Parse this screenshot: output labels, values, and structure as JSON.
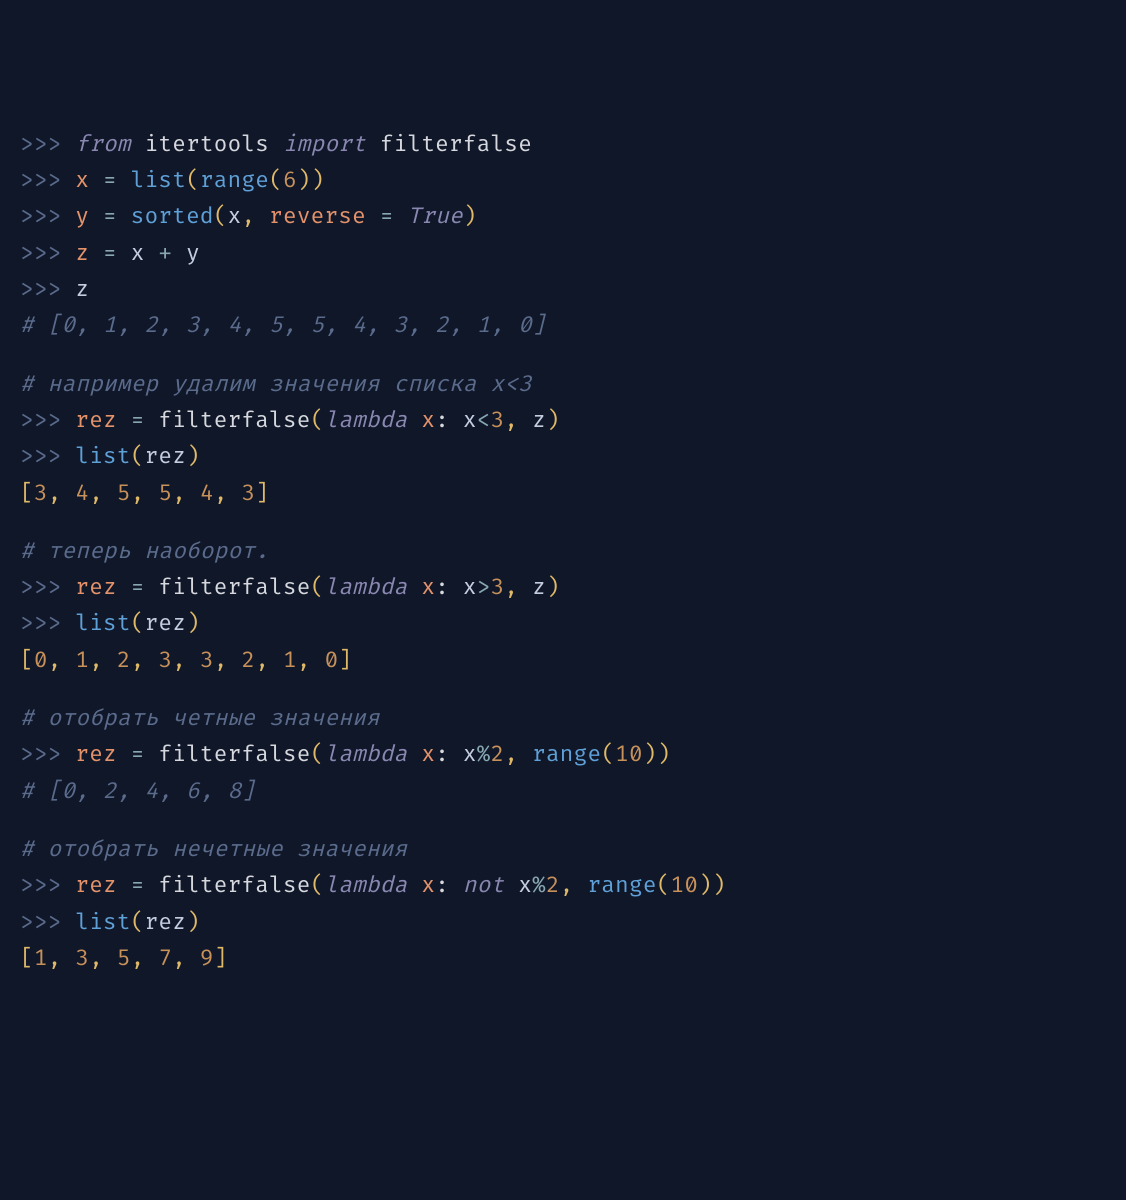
{
  "lines": [
    {
      "prompt": ">>> ",
      "segs": [
        {
          "t": "from ",
          "c": "c-kw"
        },
        {
          "t": "itertools ",
          "c": "c-ident"
        },
        {
          "t": "import ",
          "c": "c-kw"
        },
        {
          "t": "filterfalse",
          "c": "c-ident"
        }
      ]
    },
    {
      "prompt": ">>> ",
      "segs": [
        {
          "t": "x ",
          "c": "c-param"
        },
        {
          "t": "= ",
          "c": "c-op"
        },
        {
          "t": "list",
          "c": "c-fn"
        },
        {
          "t": "(",
          "c": "c-punct"
        },
        {
          "t": "range",
          "c": "c-fn"
        },
        {
          "t": "(",
          "c": "c-punct"
        },
        {
          "t": "6",
          "c": "c-num"
        },
        {
          "t": ")",
          "c": "c-punct"
        },
        {
          "t": ")",
          "c": "c-punct"
        }
      ]
    },
    {
      "prompt": ">>> ",
      "segs": [
        {
          "t": "y ",
          "c": "c-param"
        },
        {
          "t": "= ",
          "c": "c-op"
        },
        {
          "t": "sorted",
          "c": "c-fn"
        },
        {
          "t": "(",
          "c": "c-punct"
        },
        {
          "t": "x",
          "c": "c-var"
        },
        {
          "t": ", ",
          "c": "c-punct"
        },
        {
          "t": "reverse",
          "c": "c-param"
        },
        {
          "t": " = ",
          "c": "c-op"
        },
        {
          "t": "True",
          "c": "c-kw"
        },
        {
          "t": ")",
          "c": "c-punct"
        }
      ]
    },
    {
      "prompt": ">>> ",
      "segs": [
        {
          "t": "z ",
          "c": "c-param"
        },
        {
          "t": "= ",
          "c": "c-op"
        },
        {
          "t": "x ",
          "c": "c-var"
        },
        {
          "t": "+ ",
          "c": "c-op"
        },
        {
          "t": "y",
          "c": "c-var"
        }
      ]
    },
    {
      "prompt": ">>> ",
      "segs": [
        {
          "t": "z",
          "c": "c-var"
        }
      ]
    },
    {
      "prompt": "",
      "segs": [
        {
          "t": "# [0, 1, 2, 3, 4, 5, 5, 4, 3, 2, 1, 0]",
          "c": "c-comment"
        }
      ]
    },
    {
      "blank": true
    },
    {
      "prompt": "",
      "segs": [
        {
          "t": "# например удалим значения списка x<3",
          "c": "c-comment"
        }
      ]
    },
    {
      "prompt": ">>> ",
      "segs": [
        {
          "t": "rez ",
          "c": "c-param"
        },
        {
          "t": "= ",
          "c": "c-op"
        },
        {
          "t": "filterfalse",
          "c": "c-ident"
        },
        {
          "t": "(",
          "c": "c-punct"
        },
        {
          "t": "lambda ",
          "c": "c-kw"
        },
        {
          "t": "x",
          "c": "c-param"
        },
        {
          "t": ": ",
          "c": "c-punct-w"
        },
        {
          "t": "x",
          "c": "c-var"
        },
        {
          "t": "<",
          "c": "c-op"
        },
        {
          "t": "3",
          "c": "c-num"
        },
        {
          "t": ", ",
          "c": "c-punct"
        },
        {
          "t": "z",
          "c": "c-var"
        },
        {
          "t": ")",
          "c": "c-punct"
        }
      ]
    },
    {
      "prompt": ">>> ",
      "segs": [
        {
          "t": "list",
          "c": "c-fn"
        },
        {
          "t": "(",
          "c": "c-punct"
        },
        {
          "t": "rez",
          "c": "c-var"
        },
        {
          "t": ")",
          "c": "c-punct"
        }
      ]
    },
    {
      "prompt": "",
      "segs": [
        {
          "t": "[",
          "c": "c-punct"
        },
        {
          "t": "3",
          "c": "c-num"
        },
        {
          "t": ", ",
          "c": "c-punct"
        },
        {
          "t": "4",
          "c": "c-num"
        },
        {
          "t": ", ",
          "c": "c-punct"
        },
        {
          "t": "5",
          "c": "c-num"
        },
        {
          "t": ", ",
          "c": "c-punct"
        },
        {
          "t": "5",
          "c": "c-num"
        },
        {
          "t": ", ",
          "c": "c-punct"
        },
        {
          "t": "4",
          "c": "c-num"
        },
        {
          "t": ", ",
          "c": "c-punct"
        },
        {
          "t": "3",
          "c": "c-num"
        },
        {
          "t": "]",
          "c": "c-punct"
        }
      ]
    },
    {
      "blank": true
    },
    {
      "prompt": "",
      "segs": [
        {
          "t": "# теперь наоборот.",
          "c": "c-comment"
        }
      ]
    },
    {
      "prompt": ">>> ",
      "segs": [
        {
          "t": "rez ",
          "c": "c-param"
        },
        {
          "t": "= ",
          "c": "c-op"
        },
        {
          "t": "filterfalse",
          "c": "c-ident"
        },
        {
          "t": "(",
          "c": "c-punct"
        },
        {
          "t": "lambda ",
          "c": "c-kw"
        },
        {
          "t": "x",
          "c": "c-param"
        },
        {
          "t": ": ",
          "c": "c-punct-w"
        },
        {
          "t": "x",
          "c": "c-var"
        },
        {
          "t": ">",
          "c": "c-op"
        },
        {
          "t": "3",
          "c": "c-num"
        },
        {
          "t": ", ",
          "c": "c-punct"
        },
        {
          "t": "z",
          "c": "c-var"
        },
        {
          "t": ")",
          "c": "c-punct"
        }
      ]
    },
    {
      "prompt": ">>> ",
      "segs": [
        {
          "t": "list",
          "c": "c-fn"
        },
        {
          "t": "(",
          "c": "c-punct"
        },
        {
          "t": "rez",
          "c": "c-var"
        },
        {
          "t": ")",
          "c": "c-punct"
        }
      ]
    },
    {
      "prompt": "",
      "segs": [
        {
          "t": "[",
          "c": "c-punct"
        },
        {
          "t": "0",
          "c": "c-num"
        },
        {
          "t": ", ",
          "c": "c-punct"
        },
        {
          "t": "1",
          "c": "c-num"
        },
        {
          "t": ", ",
          "c": "c-punct"
        },
        {
          "t": "2",
          "c": "c-num"
        },
        {
          "t": ", ",
          "c": "c-punct"
        },
        {
          "t": "3",
          "c": "c-num"
        },
        {
          "t": ", ",
          "c": "c-punct"
        },
        {
          "t": "3",
          "c": "c-num"
        },
        {
          "t": ", ",
          "c": "c-punct"
        },
        {
          "t": "2",
          "c": "c-num"
        },
        {
          "t": ", ",
          "c": "c-punct"
        },
        {
          "t": "1",
          "c": "c-num"
        },
        {
          "t": ", ",
          "c": "c-punct"
        },
        {
          "t": "0",
          "c": "c-num"
        },
        {
          "t": "]",
          "c": "c-punct"
        }
      ]
    },
    {
      "blank": true
    },
    {
      "prompt": "",
      "segs": [
        {
          "t": "# отобрать четные значения",
          "c": "c-comment"
        }
      ]
    },
    {
      "prompt": ">>> ",
      "segs": [
        {
          "t": "rez ",
          "c": "c-param"
        },
        {
          "t": "= ",
          "c": "c-op"
        },
        {
          "t": "filterfalse",
          "c": "c-ident"
        },
        {
          "t": "(",
          "c": "c-punct"
        },
        {
          "t": "lambda ",
          "c": "c-kw"
        },
        {
          "t": "x",
          "c": "c-param"
        },
        {
          "t": ": ",
          "c": "c-punct-w"
        },
        {
          "t": "x",
          "c": "c-var"
        },
        {
          "t": "%",
          "c": "c-op"
        },
        {
          "t": "2",
          "c": "c-num"
        },
        {
          "t": ", ",
          "c": "c-punct"
        },
        {
          "t": "range",
          "c": "c-fn"
        },
        {
          "t": "(",
          "c": "c-punct"
        },
        {
          "t": "10",
          "c": "c-num"
        },
        {
          "t": ")",
          "c": "c-punct"
        },
        {
          "t": ")",
          "c": "c-punct"
        }
      ]
    },
    {
      "prompt": "",
      "segs": [
        {
          "t": "# [0, 2, 4, 6, 8]",
          "c": "c-comment"
        }
      ]
    },
    {
      "blank": true
    },
    {
      "prompt": "",
      "segs": [
        {
          "t": "# отобрать нечетные значения",
          "c": "c-comment"
        }
      ]
    },
    {
      "prompt": ">>> ",
      "segs": [
        {
          "t": "rez ",
          "c": "c-param"
        },
        {
          "t": "= ",
          "c": "c-op"
        },
        {
          "t": "filterfalse",
          "c": "c-ident"
        },
        {
          "t": "(",
          "c": "c-punct"
        },
        {
          "t": "lambda ",
          "c": "c-kw"
        },
        {
          "t": "x",
          "c": "c-param"
        },
        {
          "t": ": ",
          "c": "c-punct-w"
        },
        {
          "t": "not ",
          "c": "c-kw"
        },
        {
          "t": "x",
          "c": "c-var"
        },
        {
          "t": "%",
          "c": "c-op"
        },
        {
          "t": "2",
          "c": "c-num"
        },
        {
          "t": ", ",
          "c": "c-punct"
        },
        {
          "t": "range",
          "c": "c-fn"
        },
        {
          "t": "(",
          "c": "c-punct"
        },
        {
          "t": "10",
          "c": "c-num"
        },
        {
          "t": ")",
          "c": "c-punct"
        },
        {
          "t": ")",
          "c": "c-punct"
        }
      ]
    },
    {
      "prompt": ">>> ",
      "segs": [
        {
          "t": "list",
          "c": "c-fn"
        },
        {
          "t": "(",
          "c": "c-punct"
        },
        {
          "t": "rez",
          "c": "c-var"
        },
        {
          "t": ")",
          "c": "c-punct"
        }
      ]
    },
    {
      "prompt": "",
      "segs": [
        {
          "t": "[",
          "c": "c-punct"
        },
        {
          "t": "1",
          "c": "c-num"
        },
        {
          "t": ", ",
          "c": "c-punct"
        },
        {
          "t": "3",
          "c": "c-num"
        },
        {
          "t": ", ",
          "c": "c-punct"
        },
        {
          "t": "5",
          "c": "c-num"
        },
        {
          "t": ", ",
          "c": "c-punct"
        },
        {
          "t": "7",
          "c": "c-num"
        },
        {
          "t": ", ",
          "c": "c-punct"
        },
        {
          "t": "9",
          "c": "c-num"
        },
        {
          "t": "]",
          "c": "c-punct"
        }
      ]
    }
  ]
}
